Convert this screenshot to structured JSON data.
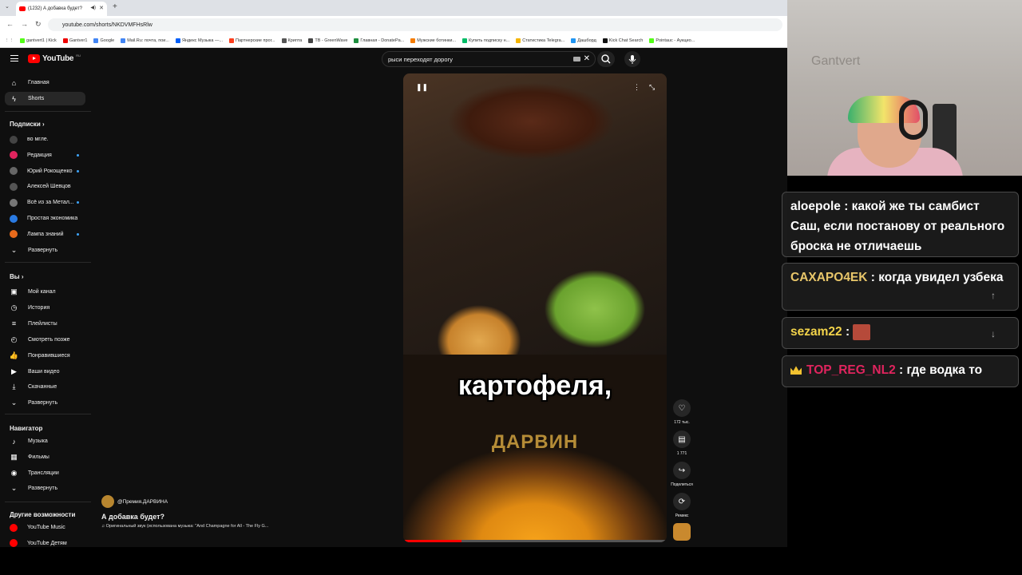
{
  "browser": {
    "tab_title": "(1232) А добавка будет?",
    "url": "youtube.com/shorts/NKDVMFHsRlw",
    "bookmarks": [
      "gantvert1 | Kick",
      "Gantver1",
      "Google",
      "Mail.Ru: почта, пои...",
      "Яндекс Музыка —...",
      "Партнерские прог...",
      "Крипта",
      "ТВ - GreenWave",
      "Главная - DonatePa...",
      "Мужские ботинки...",
      "Купить подписку н...",
      "Статистика Telegra...",
      "Дашборд",
      "Kick Chat Search",
      "Pointauc - Аукцио..."
    ]
  },
  "youtube": {
    "logo": "YouTube",
    "logo_region": "RU",
    "search_value": "рыси переходят дорогу",
    "sidebar": {
      "home": "Главная",
      "shorts": "Shorts",
      "subs_title": "Подписки",
      "subs": [
        {
          "label": "во мгле.",
          "color": "#444",
          "new": false
        },
        {
          "label": "Редакция",
          "color": "#e0245e",
          "new": true
        },
        {
          "label": "Юрий Рокощенко",
          "color": "#666",
          "new": true
        },
        {
          "label": "Алексей Шевцов",
          "color": "#555",
          "new": false
        },
        {
          "label": "Всё из за Метал...",
          "color": "#777",
          "new": true
        },
        {
          "label": "Простая экономика",
          "color": "#2a7ae2",
          "new": false
        },
        {
          "label": "Лампа знаний",
          "color": "#e86a1b",
          "new": true
        }
      ],
      "expand": "Развернуть",
      "you_title": "Вы",
      "you_items": [
        "Мой канал",
        "История",
        "Плейлисты",
        "Смотреть позже",
        "Понравившиеся",
        "Ваши видео",
        "Скачанные",
        "Развернуть"
      ],
      "nav_title": "Навигатор",
      "nav_items": [
        "Музыка",
        "Фильмы",
        "Трансляции",
        "Развернуть"
      ],
      "other_title": "Другие возможности",
      "other_items": [
        "YouTube Music",
        "YouTube Детям"
      ]
    },
    "short": {
      "caption": "картофеля,",
      "watermark": "ДАРВИН",
      "channel": "@Премия.ДАРВИНА",
      "title": "А добавка будет?",
      "music": "Оригинальный звук (использована музыка: \"And Champagne for All - The Fly G...",
      "progress": 0.22,
      "likes": "172 тыс.",
      "comments": "1 771",
      "share": "Поделиться",
      "remix": "Ремикс"
    }
  },
  "webcam": {
    "wall_text": "Gantvert"
  },
  "chat": [
    {
      "user": "aloepole",
      "user_color": "#ffffff",
      "text": "какой же ты самбист Саш, если постанову от реального броска не отличаешь"
    },
    {
      "user": "CAXAPO4EK",
      "user_color": "#e8c66a",
      "text": "когда увидел узбека"
    },
    {
      "user": "sezam22",
      "user_color": "#f2d34a",
      "text": ""
    },
    {
      "user": "TOP_REG_NL2",
      "user_color": "#e0245e",
      "text": "где водка то"
    }
  ]
}
